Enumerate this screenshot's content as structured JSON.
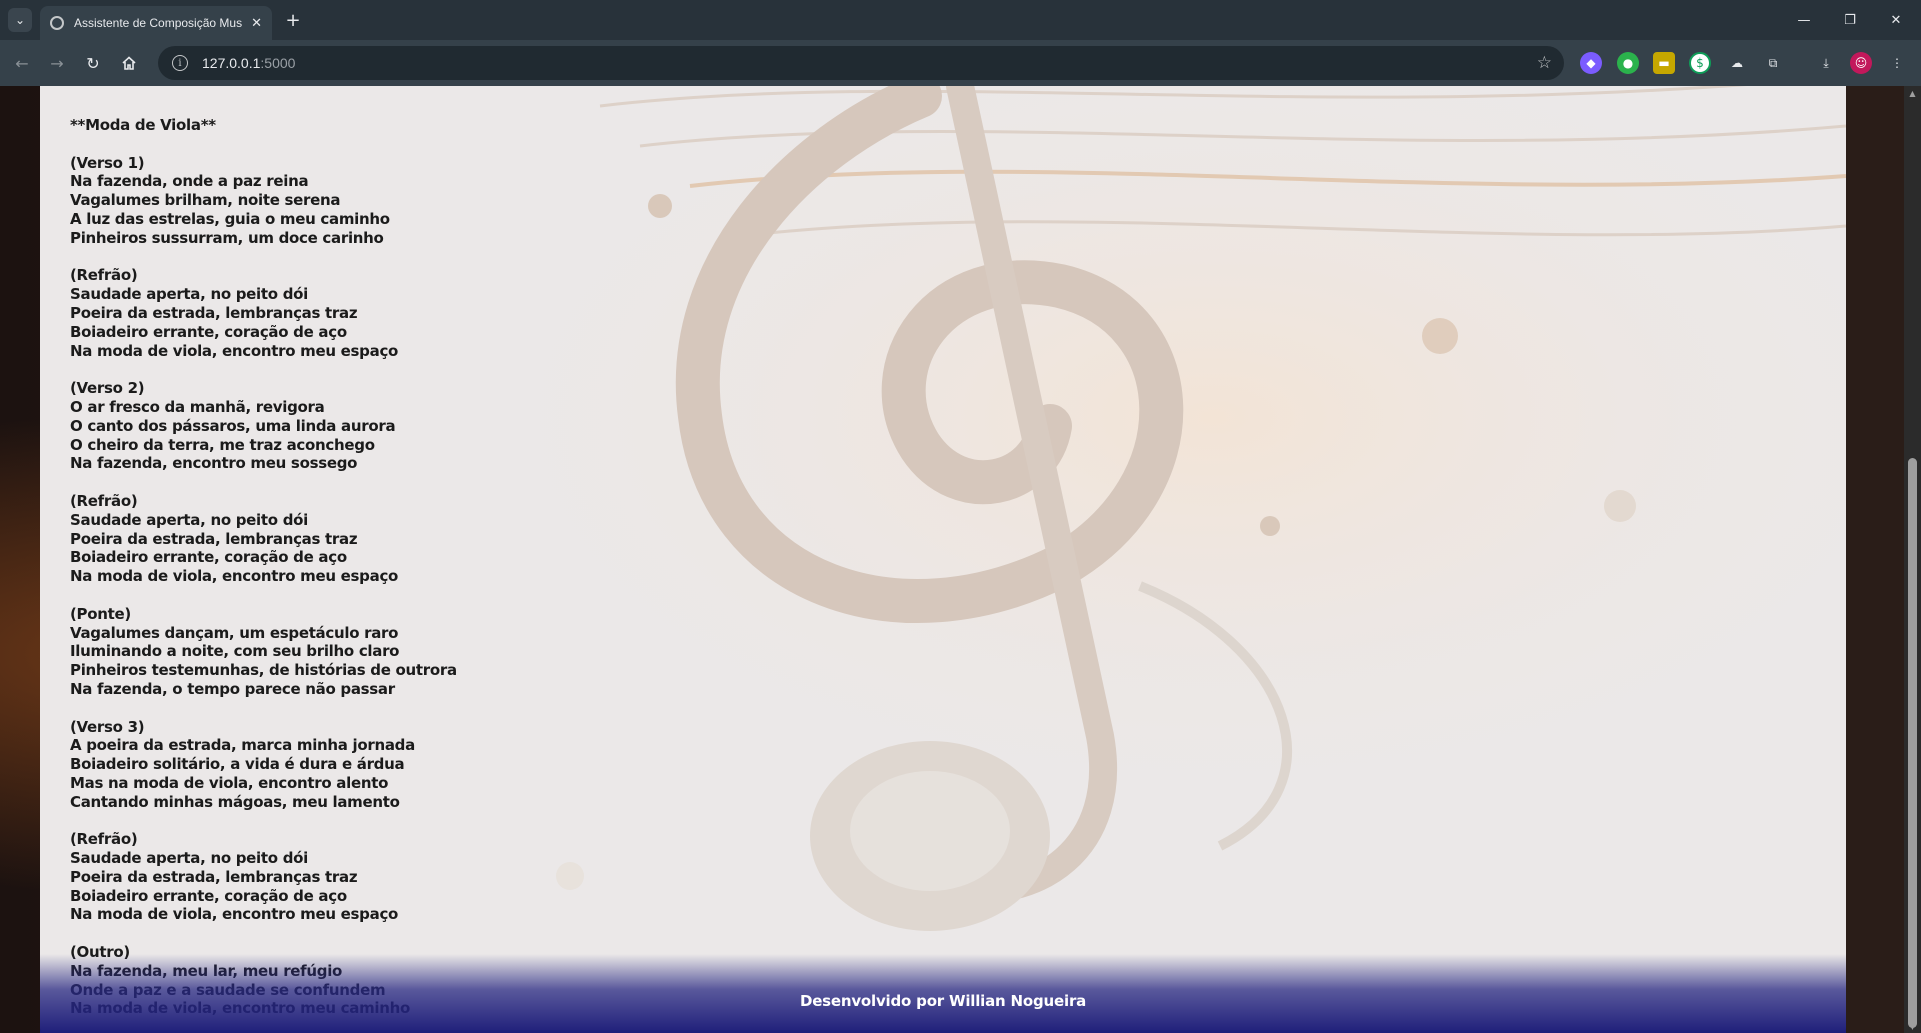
{
  "browser": {
    "tab_title": "Assistente de Composição Mus",
    "tab_close": "✕",
    "new_tab": "+",
    "url_host": "127.0.0.1",
    "url_port": ":5000",
    "window_minimize": "—",
    "window_restore": "❐",
    "window_close": "✕"
  },
  "icons": {
    "tab_search": "chevron-down-icon",
    "back": "arrow-left-icon",
    "forward": "arrow-right-icon",
    "reload": "reload-icon",
    "home": "home-icon",
    "site_info": "info-icon",
    "bookmark": "star-icon",
    "extensions": "puzzle-icon",
    "downloads": "download-icon",
    "profile": "avatar-icon",
    "menu": "kebab-menu-icon"
  },
  "lyrics": {
    "text": "**Moda de Viola**\n\n(Verso 1)\nNa fazenda, onde a paz reina\nVagalumes brilham, noite serena\nA luz das estrelas, guia o meu caminho\nPinheiros sussurram, um doce carinho\n\n(Refrão)\nSaudade aperta, no peito dói\nPoeira da estrada, lembranças traz\nBoiadeiro errante, coração de aço\nNa moda de viola, encontro meu espaço\n\n(Verso 2)\nO ar fresco da manhã, revigora\nO canto dos pássaros, uma linda aurora\nO cheiro da terra, me traz aconchego\nNa fazenda, encontro meu sossego\n\n(Refrão)\nSaudade aperta, no peito dói\nPoeira da estrada, lembranças traz\nBoiadeiro errante, coração de aço\nNa moda de viola, encontro meu espaço\n\n(Ponte)\nVagalumes dançam, um espetáculo raro\nIluminando a noite, com seu brilho claro\nPinheiros testemunhas, de histórias de outrora\nNa fazenda, o tempo parece não passar\n\n(Verso 3)\nA poeira da estrada, marca minha jornada\nBoiadeiro solitário, a vida é dura e árdua\nMas na moda de viola, encontro alento\nCantando minhas mágoas, meu lamento\n\n(Refrão)\nSaudade aperta, no peito dói\nPoeira da estrada, lembranças traz\nBoiadeiro errante, coração de aço\nNa moda de viola, encontro meu espaço\n\n(Outro)\nNa fazenda, meu lar, meu refúgio\nOnde a paz e a saudade se confundem\nNa moda de viola, encontro meu caminho"
  },
  "footer": {
    "credit": "Desenvolvido por Willian Nogueira"
  },
  "colors": {
    "card_bg": "#ebe8e8",
    "footer_bg": "#1f1f7a",
    "lyrics_text": "#1b1b1b"
  }
}
